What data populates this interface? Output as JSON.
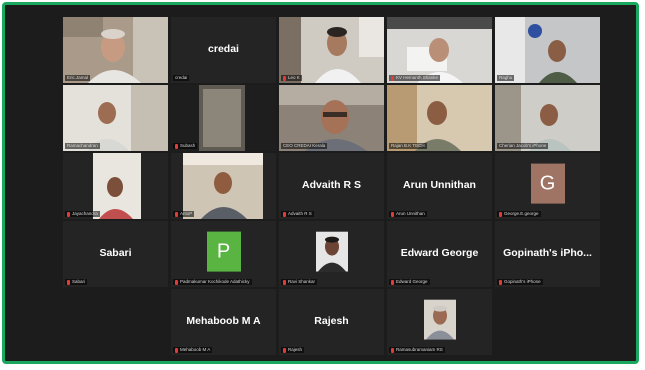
{
  "meeting": {
    "tiles": [
      {
        "id": "t1",
        "label": "Eric.Jamal",
        "muted": false
      },
      {
        "id": "t2",
        "name": "credai",
        "label": "credai",
        "muted": false
      },
      {
        "id": "t3",
        "label": "Leo K",
        "muted": true
      },
      {
        "id": "t4",
        "label": "KV Hemanth Shanke",
        "muted": true
      },
      {
        "id": "t5",
        "label": "Raghu",
        "muted": false
      },
      {
        "id": "t6",
        "label": "Ramachandran",
        "muted": false
      },
      {
        "id": "t7",
        "label": "Subash",
        "muted": true
      },
      {
        "id": "t8",
        "label": "CEO CREDAI Kerala",
        "muted": false
      },
      {
        "id": "t9",
        "label": "Rajan B.K TECH",
        "muted": false
      },
      {
        "id": "t10",
        "label": "Cherian Jacob's iPhone",
        "muted": false
      },
      {
        "id": "t11",
        "label": "Jayachandra",
        "muted": true
      },
      {
        "id": "t12",
        "label": "AntoP",
        "muted": true
      },
      {
        "id": "t13",
        "name": "Advaith R S",
        "label": "Advaith R S",
        "muted": true
      },
      {
        "id": "t14",
        "name": "Arun Unnithan",
        "label": "Arun Unnithan",
        "muted": true
      },
      {
        "id": "t15",
        "initial": "G",
        "label": "George.E.george",
        "muted": true
      },
      {
        "id": "t16",
        "name": "Sabari",
        "label": "Sabari",
        "muted": true
      },
      {
        "id": "t17",
        "initial": "P",
        "label": "Padmakumar Kochikode Adathicky",
        "muted": true
      },
      {
        "id": "t18",
        "label": "Ravi Shankar",
        "muted": true
      },
      {
        "id": "t19",
        "name": "Edward George",
        "label": "Edward George",
        "muted": true
      },
      {
        "id": "t20",
        "name": "Gopinath's iPho...",
        "label": "Gopinath's iPhone",
        "muted": true
      },
      {
        "id": "t21",
        "hidden": true
      },
      {
        "id": "t22",
        "name": "Mehaboob M A",
        "label": "Mehaboob M A",
        "muted": true
      },
      {
        "id": "t23",
        "name": "Rajesh",
        "label": "Rajesh",
        "muted": true
      },
      {
        "id": "t24",
        "label": "Ramasubramaniam RS",
        "muted": true
      },
      {
        "id": "t25",
        "hidden": true
      }
    ]
  },
  "colors": {
    "frame_border": "#19a85e",
    "active_speaker": "#c9d63c",
    "avatar_g": "#a07464",
    "avatar_p": "#59b441"
  }
}
